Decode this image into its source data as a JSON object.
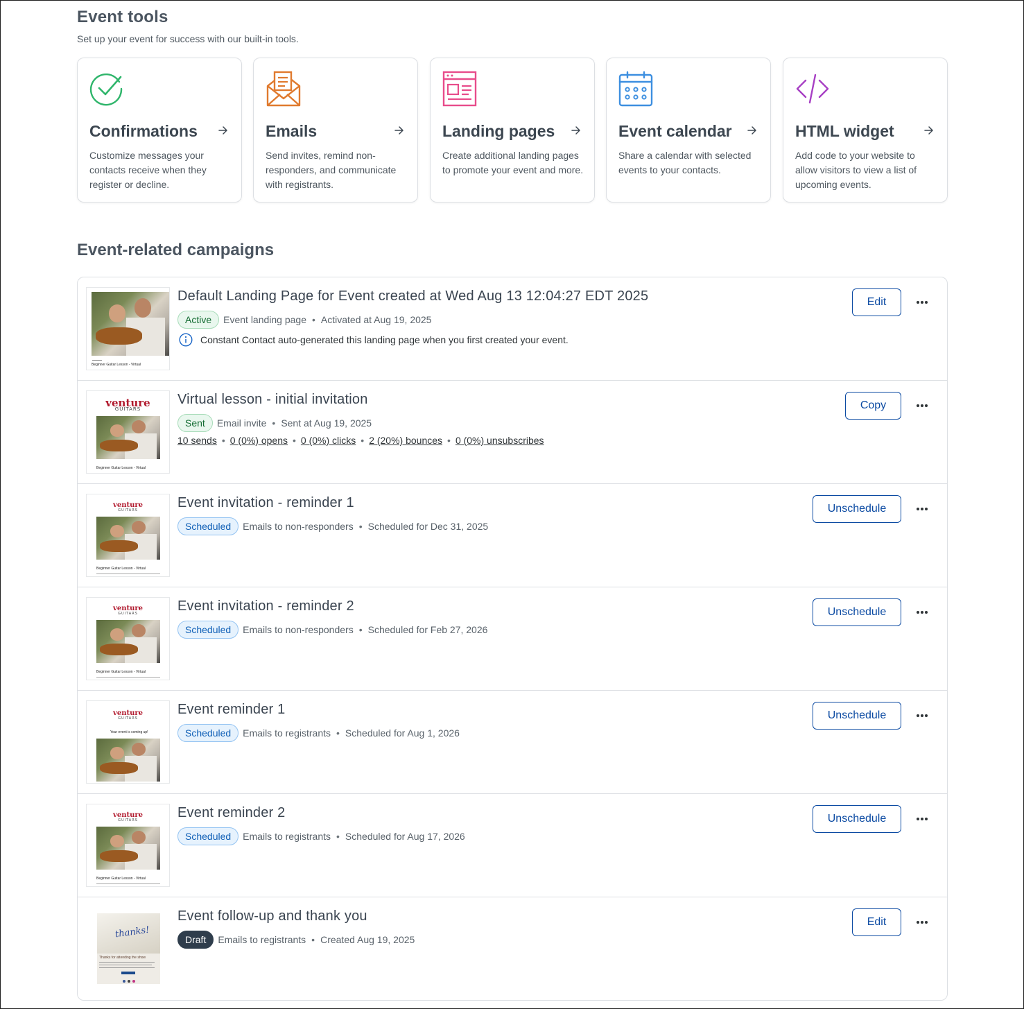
{
  "event_tools": {
    "title": "Event tools",
    "subtitle": "Set up your event for success with our built-in tools.",
    "cards": [
      {
        "title": "Confirmations",
        "desc": "Customize messages your contacts receive when they register or decline.",
        "icon": "check-circle-icon",
        "color": "#2fb56b"
      },
      {
        "title": "Emails",
        "desc": "Send invites, remind non-responders, and communicate with registrants.",
        "icon": "envelope-icon",
        "color": "#e07a2e"
      },
      {
        "title": "Landing pages",
        "desc": "Create additional landing pages to promote your event and more.",
        "icon": "landing-page-icon",
        "color": "#e84c8b"
      },
      {
        "title": "Event calendar",
        "desc": "Share a calendar with selected events to your contacts.",
        "icon": "calendar-icon",
        "color": "#3d8fe0"
      },
      {
        "title": "HTML widget",
        "desc": "Add code to your website to allow visitors to view a list of upcoming events.",
        "icon": "code-icon",
        "color": "#a73fc4"
      }
    ]
  },
  "campaigns": {
    "title": "Event-related campaigns",
    "items": [
      {
        "title": "Default Landing Page for Event created at Wed Aug 13 12:04:27 EDT 2025",
        "status": "Active",
        "type": "Event landing page",
        "date": "Activated at Aug 19, 2025",
        "info": "Constant Contact auto-generated this landing page when you first created your event.",
        "action": "Edit",
        "thumb_caption": "Beginner Guitar Lesson - Virtual"
      },
      {
        "title": "Virtual lesson - initial invitation",
        "status": "Sent",
        "type": "Email invite",
        "date": "Sent at Aug 19, 2025",
        "stats": [
          "10 sends",
          "0 (0%) opens",
          "0 (0%) clicks",
          "2 (20%) bounces",
          "0 (0%) unsubscribes"
        ],
        "action": "Copy",
        "thumb_logo": "venture",
        "thumb_logo_sub": "GUITARS",
        "thumb_caption": "Beginner Guitar Lesson - Virtual"
      },
      {
        "title": "Event invitation - reminder 1",
        "status": "Scheduled",
        "type": "Emails to non-responders",
        "date": "Scheduled for Dec 31, 2025",
        "action": "Unschedule",
        "thumb_logo": "venture",
        "thumb_logo_sub": "GUITARS",
        "thumb_caption": "Beginner Guitar Lesson - Virtual"
      },
      {
        "title": "Event invitation - reminder 2",
        "status": "Scheduled",
        "type": "Emails to non-responders",
        "date": "Scheduled for Feb 27, 2026",
        "action": "Unschedule",
        "thumb_logo": "venture",
        "thumb_logo_sub": "GUITARS",
        "thumb_caption": "Beginner Guitar Lesson - Virtual"
      },
      {
        "title": "Event reminder 1",
        "status": "Scheduled",
        "type": "Emails to registrants",
        "date": "Scheduled for Aug 1, 2026",
        "action": "Unschedule",
        "thumb_logo": "venture",
        "thumb_logo_sub": "GUITARS",
        "thumb_tagline": "Your event is coming up!"
      },
      {
        "title": "Event reminder 2",
        "status": "Scheduled",
        "type": "Emails to registrants",
        "date": "Scheduled for Aug 17, 2026",
        "action": "Unschedule",
        "thumb_logo": "venture",
        "thumb_logo_sub": "GUITARS",
        "thumb_caption": "Beginner Guitar Lesson - Virtual"
      },
      {
        "title": "Event follow-up and thank you",
        "status": "Draft",
        "type": "Emails to registrants",
        "date": "Created Aug 19, 2025",
        "action": "Edit",
        "thumb_word": "thanks!",
        "thumb_caption": "Thanks for attending the show"
      }
    ]
  },
  "colors": {
    "brand_blue": "#0b4aa2",
    "active_green": "#136b32",
    "scheduled_blue": "#0f5fb6",
    "draft_dark": "#2f3d4c"
  }
}
